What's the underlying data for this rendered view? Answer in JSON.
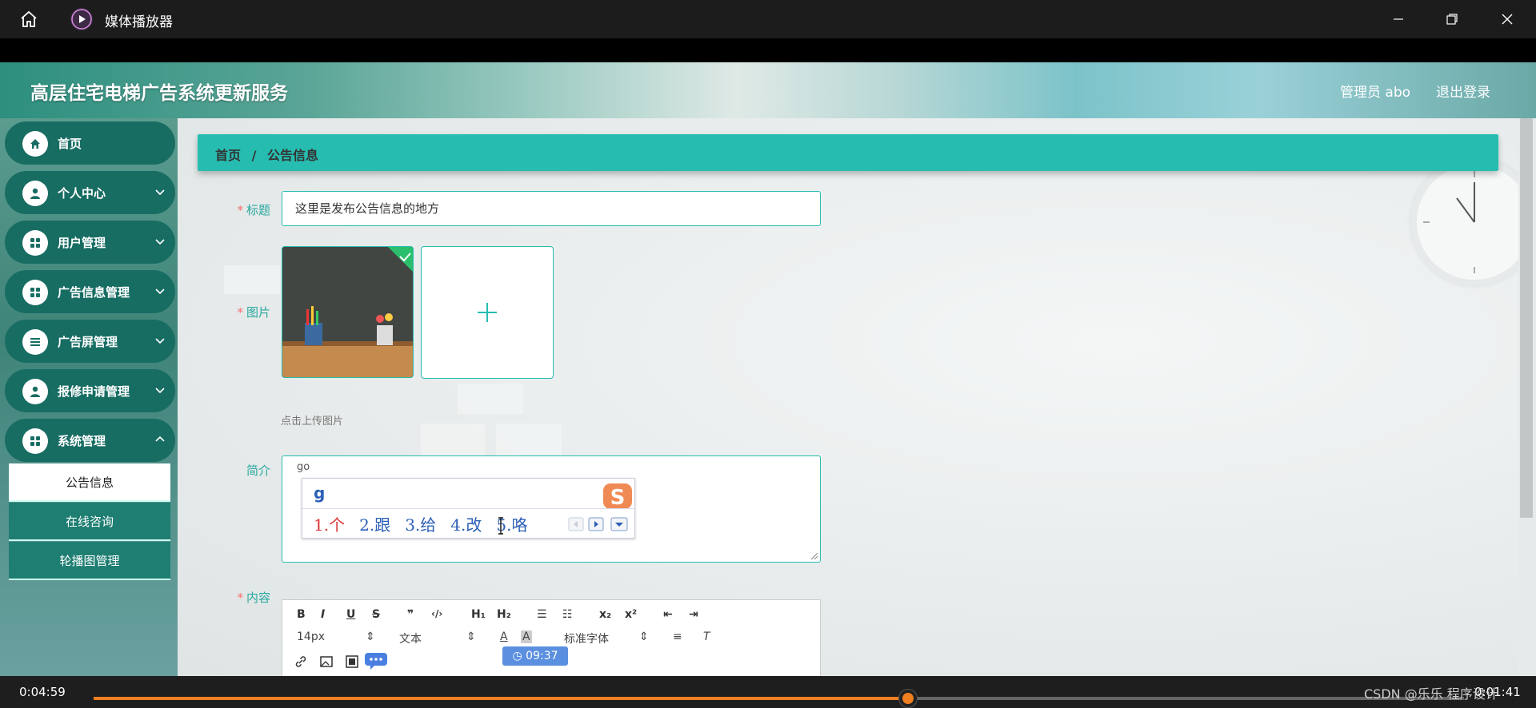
{
  "player": {
    "title": "媒体播放器"
  },
  "header": {
    "site_title": "高层住宅电梯广告系统更新服务",
    "admin_label": "管理员 abo",
    "logout": "退出登录"
  },
  "sidebar": {
    "items": [
      {
        "label": "首页",
        "icon": "home-icon"
      },
      {
        "label": "个人中心",
        "icon": "person-icon"
      },
      {
        "label": "用户管理",
        "icon": "grid-icon"
      },
      {
        "label": "广告信息管理",
        "icon": "grid-icon"
      },
      {
        "label": "广告屏管理",
        "icon": "list-icon"
      },
      {
        "label": "报修申请管理",
        "icon": "person-icon"
      },
      {
        "label": "系统管理",
        "icon": "grid-icon"
      }
    ],
    "sub_items": [
      {
        "label": "公告信息",
        "active": true
      },
      {
        "label": "在线咨询",
        "active": false
      },
      {
        "label": "轮播图管理",
        "active": false
      }
    ]
  },
  "breadcrumb": {
    "home": "首页",
    "sep": "/",
    "current": "公告信息"
  },
  "form": {
    "title_label": "标题",
    "title_value": "这里是发布公告信息的地方",
    "image_label": "图片",
    "upload_hint": "点击上传图片",
    "intro_label": "简介",
    "intro_value": "go",
    "content_label": "内容",
    "required_mark": "*"
  },
  "ime": {
    "input": "g",
    "candidates": [
      "1.个",
      "2.跟",
      "3.给",
      "4.改",
      "5.咯"
    ]
  },
  "editor_toolbar": {
    "row1": [
      "B",
      "I",
      "U",
      "S",
      "❞",
      "‹/›",
      "H₁",
      "H₂",
      "☰",
      "☷",
      "x₂",
      "x²",
      "⇤",
      "⇥"
    ],
    "font_size": "14px",
    "paragraph": "文本",
    "font_family": "标准字体"
  },
  "overlay": {
    "time_badge": "09:37"
  },
  "playback": {
    "current_time": "0:04:59",
    "total_time": "0:01:41",
    "progress": 0.594,
    "watermark": "CSDN @乐乐 程序设计"
  },
  "colors": {
    "accent": "#26bdb0",
    "sidebar_item": "#186d63",
    "progress": "#f07f1f",
    "required": "#f56c6c"
  }
}
